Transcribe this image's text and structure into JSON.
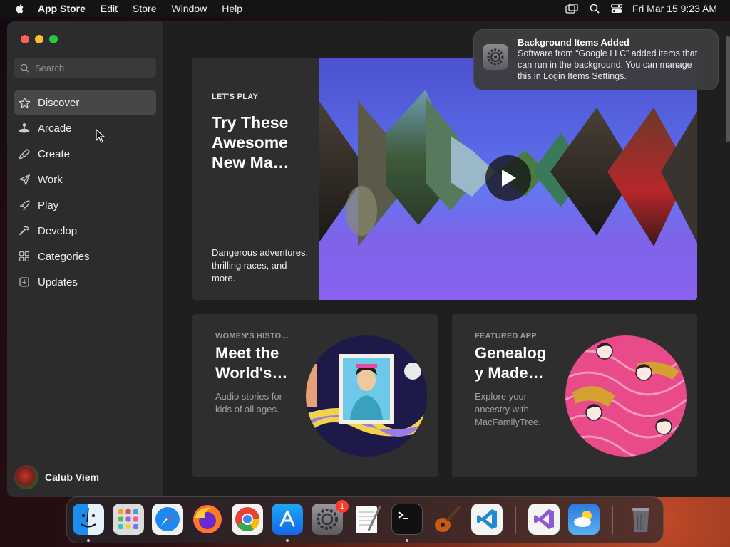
{
  "menubar": {
    "app_name": "App Store",
    "menus": [
      "Edit",
      "Store",
      "Window",
      "Help"
    ],
    "datetime": "Fri Mar 15  9:23 AM"
  },
  "sidebar": {
    "search_placeholder": "Search",
    "items": [
      {
        "label": "Discover",
        "icon": "star-icon"
      },
      {
        "label": "Arcade",
        "icon": "joystick-icon"
      },
      {
        "label": "Create",
        "icon": "paintbrush-icon"
      },
      {
        "label": "Work",
        "icon": "paperplane-icon"
      },
      {
        "label": "Play",
        "icon": "rocket-icon"
      },
      {
        "label": "Develop",
        "icon": "hammer-icon"
      },
      {
        "label": "Categories",
        "icon": "grid-icon"
      },
      {
        "label": "Updates",
        "icon": "download-icon"
      }
    ],
    "active_item": "Discover",
    "user_name": "Calub Viem"
  },
  "hero": {
    "eyebrow": "LET'S PLAY",
    "title": "Try These Awesome New Ma…",
    "description": "Dangerous adventures, thrilling races, and more."
  },
  "cards": [
    {
      "eyebrow": "WOMEN'S HISTO…",
      "title": "Meet the World's…",
      "description": "Audio stories for kids of all ages."
    },
    {
      "eyebrow": "FEATURED APP",
      "title": "Genealog y Made…",
      "description": "Explore your ancestry with MacFamilyTree."
    }
  ],
  "notification": {
    "title": "Background Items Added",
    "body": "Software from “Google LLC” added items that can run in the background. You can manage this in Login Items Settings."
  },
  "dock": {
    "apps": [
      "Finder",
      "Launchpad",
      "Safari",
      "Firefox",
      "Chrome",
      "App Store",
      "System Settings",
      "TextEdit",
      "Terminal",
      "GarageBand",
      "Visual Studio Code",
      "Visual Studio",
      "Weather",
      "Trash"
    ],
    "settings_badge": "1"
  }
}
